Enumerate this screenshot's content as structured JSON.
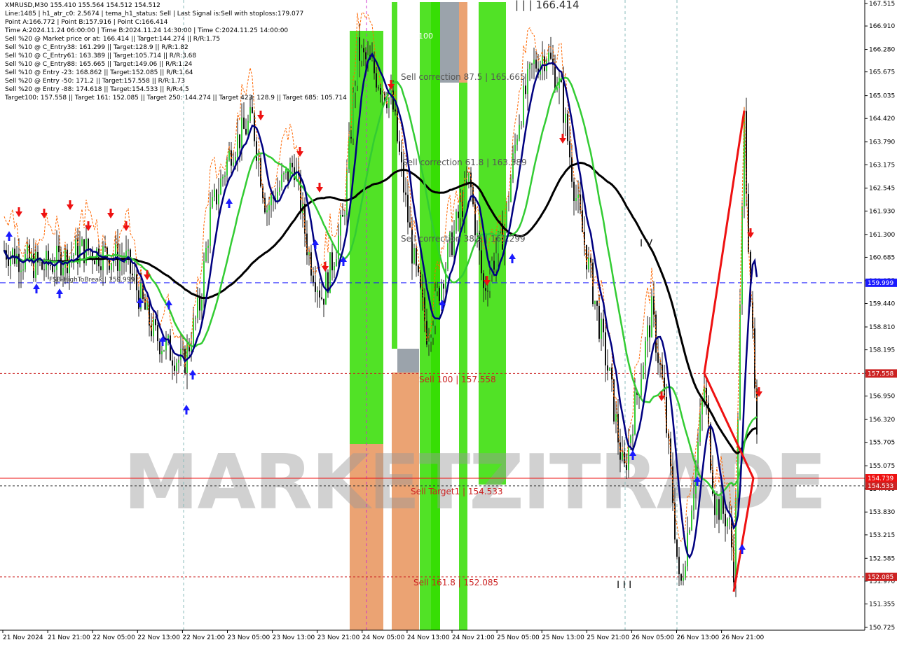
{
  "header": {
    "lines": [
      "XMRUSD,M30  155.410 155.564 154.512 154.512",
      "Line:1485  |  h1_atr_c0: 2.5674  |  tema_h1_status: Sell  |  Last Signal is:Sell with stoploss:179.077",
      "Point A:166.772  |  Point B:157.916  |  Point C:166.414",
      "Time A:2024.11.24 06:00:00  |  Time B:2024.11.24 14:30:00  |  Time C:2024.11.25 14:00:00",
      "Sell %20 @ Market price or at: 166.414  ||  Target:144.274  ||  R/R:1.75",
      "Sell %10 @ C_Entry38: 161.299  ||  Target:128.9  ||  R/R:1.82",
      "Sell %10 @ C_Entry61: 163.389  ||  Target:105.714  ||  R/R:3.68",
      "Sell %10 @ C_Entry88: 165.665  ||  Target:149.06  ||  R/R:1.24",
      "Sell %10 @ Entry -23: 168.862  ||  Target:152.085  ||  R/R:1.64",
      "Sell %20 @ Entry -50: 171.2  ||  Target:157.558  ||  R/R:1.73",
      "Sell %20 @ Entry -88: 174.618  ||  Target:154.533  ||  R/R:4.5",
      "Target100: 157.558  ||  Target 161: 152.085  ||  Target 250: 144.274  ||  Target 423: 128.9  ||  Target 685: 105.714"
    ]
  },
  "chart_data": {
    "type": "candlestick",
    "symbol": "XMRUSD",
    "timeframe": "M30",
    "ylim": [
      150.725,
      167.515
    ],
    "y_ticks": [
      167.515,
      166.91,
      166.28,
      165.675,
      165.035,
      164.42,
      163.79,
      163.175,
      162.545,
      161.93,
      161.3,
      160.685,
      160.055,
      159.44,
      158.81,
      158.195,
      157.565,
      156.95,
      156.32,
      155.705,
      155.075,
      154.46,
      153.83,
      153.215,
      152.585,
      151.97,
      151.355,
      150.725
    ],
    "x_labels": [
      "21 Nov 2024",
      "21 Nov 21:00",
      "22 Nov 05:00",
      "22 Nov 13:00",
      "22 Nov 21:00",
      "23 Nov 05:00",
      "23 Nov 13:00",
      "23 Nov 21:00",
      "24 Nov 05:00",
      "24 Nov 13:00",
      "24 Nov 21:00",
      "25 Nov 05:00",
      "25 Nov 13:00",
      "25 Nov 21:00",
      "26 Nov 05:00",
      "26 Nov 13:00",
      "26 Nov 21:00"
    ],
    "price_tags": [
      {
        "value": "159.999",
        "color": "#1a1aff"
      },
      {
        "value": "157.558",
        "color": "#cc2222"
      },
      {
        "value": "154.739",
        "color": "#ee1111"
      },
      {
        "value": "154.533",
        "color": "#cc2222"
      },
      {
        "value": "152.085",
        "color": "#cc2222"
      }
    ],
    "levels": [
      {
        "label": "Sell 100 | 157.558",
        "price": 157.558
      },
      {
        "label": "Sell Target1 | 154.533",
        "price": 154.533
      },
      {
        "label": "Sell 161.8 | 152.085",
        "price": 152.085
      },
      {
        "label": "Sell correction 87.5 | 165.665",
        "price": 165.665
      },
      {
        "label": "Sell correction 61.8 | 163.389",
        "price": 163.389
      },
      {
        "label": "Sell correction 38.2 | 161.299",
        "price": 161.299
      }
    ],
    "annotations": [
      "| | | 166.414",
      "100",
      "I V",
      "I I I",
      "FSB-HighToBreak | 159.999"
    ],
    "watermark": "MARKETZITRADE",
    "colors": {
      "blue_ma": "#000080",
      "green_ma": "#33cc33",
      "black_ma": "#000000",
      "orange_env": "#ff6600",
      "bull": "#33cc33",
      "bear": "#ee2222",
      "zone_green": "#33dd00",
      "zone_orange": "#e8935a"
    }
  }
}
